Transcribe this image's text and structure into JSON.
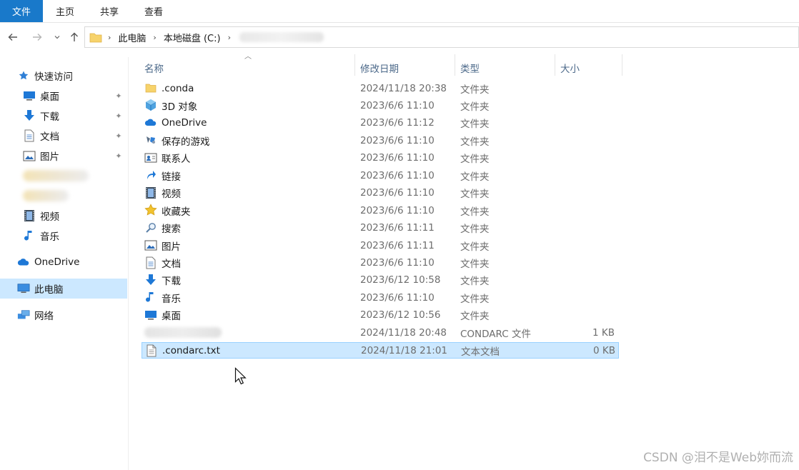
{
  "ribbon": {
    "tabs": [
      {
        "label": "文件",
        "active": true
      },
      {
        "label": "主页"
      },
      {
        "label": "共享"
      },
      {
        "label": "查看"
      }
    ],
    "accent": "#1979ca"
  },
  "address": {
    "crumbs": [
      "此电脑",
      "本地磁盘 (C:)"
    ]
  },
  "sidebar": {
    "quick_access": "快速访问",
    "pinned": [
      {
        "label": "桌面",
        "icon": "desktop-icon"
      },
      {
        "label": "下载",
        "icon": "download-icon"
      },
      {
        "label": "文档",
        "icon": "document-icon"
      },
      {
        "label": "图片",
        "icon": "pictures-icon"
      }
    ],
    "more": [
      {
        "label": "视频",
        "icon": "video-icon"
      },
      {
        "label": "音乐",
        "icon": "music-icon"
      }
    ],
    "onedrive": "OneDrive",
    "this_pc": "此电脑",
    "network": "网络"
  },
  "list": {
    "columns": {
      "name": "名称",
      "date": "修改日期",
      "type": "类型",
      "size": "大小"
    },
    "rows": [
      {
        "name": ".conda",
        "date": "2024/11/18 20:38",
        "type": "文件夹",
        "size": "",
        "icon": "folder-icon"
      },
      {
        "name": "3D 对象",
        "date": "2023/6/6 11:10",
        "type": "文件夹",
        "size": "",
        "icon": "3d-objects-icon"
      },
      {
        "name": "OneDrive",
        "date": "2023/6/6 11:12",
        "type": "文件夹",
        "size": "",
        "icon": "onedrive-icon"
      },
      {
        "name": "保存的游戏",
        "date": "2023/6/6 11:10",
        "type": "文件夹",
        "size": "",
        "icon": "saved-games-icon"
      },
      {
        "name": "联系人",
        "date": "2023/6/6 11:10",
        "type": "文件夹",
        "size": "",
        "icon": "contacts-icon"
      },
      {
        "name": "链接",
        "date": "2023/6/6 11:10",
        "type": "文件夹",
        "size": "",
        "icon": "links-icon"
      },
      {
        "name": "视频",
        "date": "2023/6/6 11:10",
        "type": "文件夹",
        "size": "",
        "icon": "video-icon"
      },
      {
        "name": "收藏夹",
        "date": "2023/6/6 11:10",
        "type": "文件夹",
        "size": "",
        "icon": "favorites-icon"
      },
      {
        "name": "搜索",
        "date": "2023/6/6 11:11",
        "type": "文件夹",
        "size": "",
        "icon": "search-icon"
      },
      {
        "name": "图片",
        "date": "2023/6/6 11:11",
        "type": "文件夹",
        "size": "",
        "icon": "pictures-icon"
      },
      {
        "name": "文档",
        "date": "2023/6/6 11:10",
        "type": "文件夹",
        "size": "",
        "icon": "document-icon"
      },
      {
        "name": "下载",
        "date": "2023/6/12 10:58",
        "type": "文件夹",
        "size": "",
        "icon": "download-icon"
      },
      {
        "name": "音乐",
        "date": "2023/6/6 11:10",
        "type": "文件夹",
        "size": "",
        "icon": "music-icon"
      },
      {
        "name": "桌面",
        "date": "2023/6/12 10:56",
        "type": "文件夹",
        "size": "",
        "icon": "desktop-icon"
      },
      {
        "name": "",
        "date": "2024/11/18 20:48",
        "type": "CONDARC 文件",
        "size": "1 KB",
        "icon": ""
      },
      {
        "name": ".condarc.txt",
        "date": "2024/11/18 21:01",
        "type": "文本文档",
        "size": "0 KB",
        "icon": "text-file-icon",
        "selected": true
      }
    ]
  },
  "watermark": "CSDN @泪不是Web妳而流"
}
